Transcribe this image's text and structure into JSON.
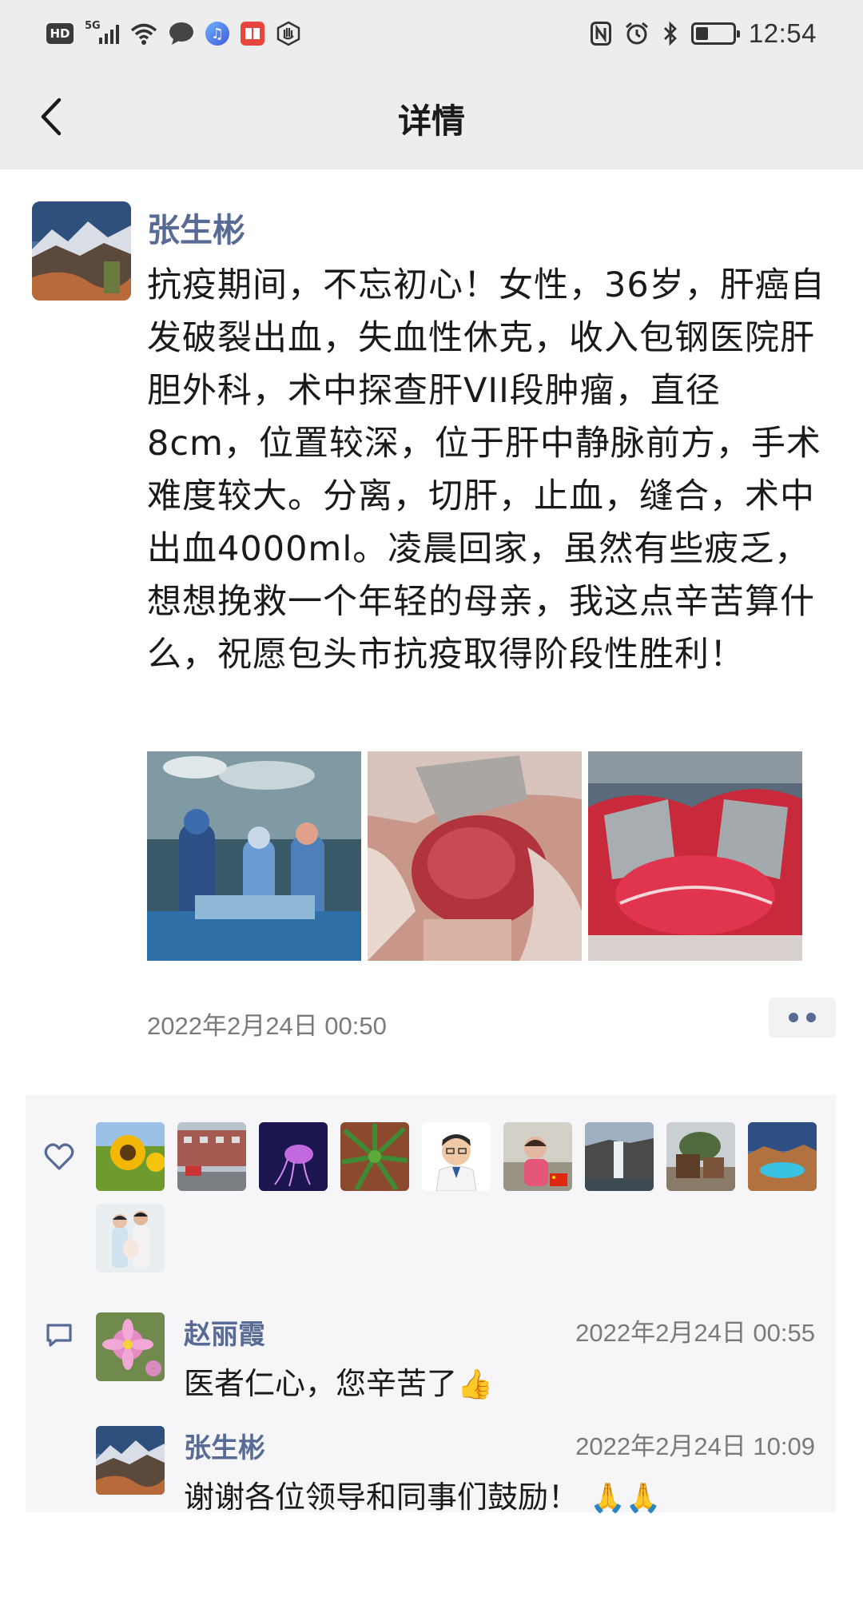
{
  "status_bar": {
    "hd": "HD",
    "network": "5G",
    "time": "12:54",
    "battery_level": 0.35,
    "left_icons": [
      "hd-icon",
      "signal-icon",
      "wifi-icon",
      "chat-bubble-icon",
      "music-app-icon",
      "book-app-icon",
      "hand-icon"
    ],
    "right_icons": [
      "nfc-icon",
      "alarm-icon",
      "bluetooth-icon",
      "battery-icon"
    ]
  },
  "nav": {
    "title": "详情",
    "back_icon": "chevron-left-icon"
  },
  "post": {
    "author": "张生彬",
    "text": "抗疫期间，不忘初心！女性，36岁，肝癌自发破裂出血，失血性休克，收入包钢医院肝胆外科，术中探查肝VII段肿瘤，直径8cm，位置较深，位于肝中静脉前方，手术难度较大。分离，切肝，止血，缝合，术中出血4000ml。凌晨回家，虽然有些疲乏，想想挽救一个年轻的母亲，我这点辛苦算什么，祝愿包头市抗疫取得阶段性胜利！",
    "time": "2022年2月24日 00:50",
    "photo_count": 3
  },
  "likes": {
    "icon": "heart-outline-icon",
    "count": 10
  },
  "comments": {
    "icon": "comment-icon",
    "items": [
      {
        "name": "赵丽霞",
        "time": "2022年2月24日 00:55",
        "text": "医者仁心，您辛苦了",
        "emoji": "👍"
      },
      {
        "name": "张生彬",
        "time": "2022年2月24日 10:09",
        "text": "谢谢各位领导和同事们鼓励！",
        "emoji": "🙏🙏"
      }
    ]
  },
  "colors": {
    "bar_bg": "#ededed",
    "name_blue": "#576b95",
    "panel_bg": "#f6f6f8",
    "time_gray": "#7a7a7a"
  }
}
